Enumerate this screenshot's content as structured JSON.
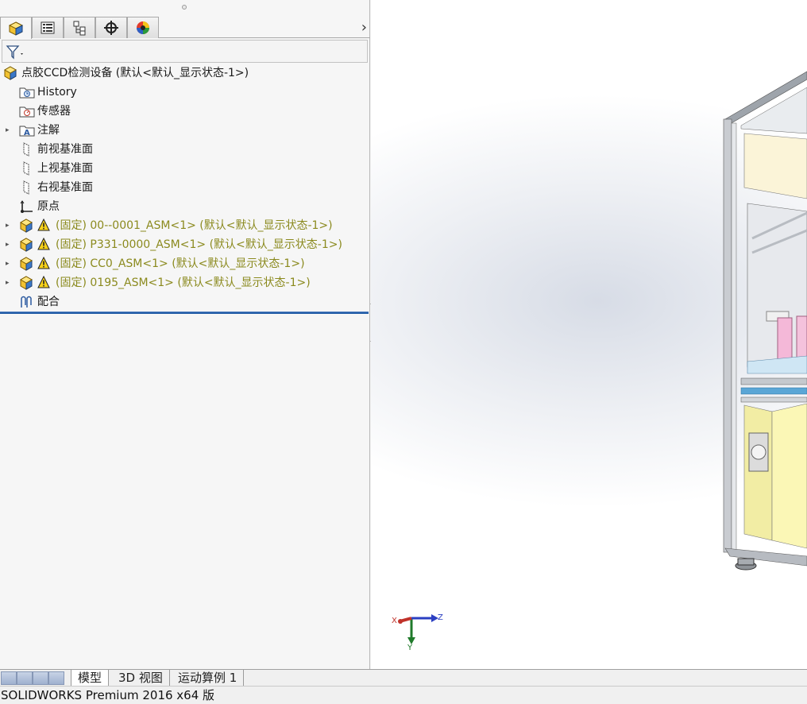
{
  "feature_tree": {
    "root": {
      "label": "点胶CCD检测设备  (默认<默认_显示状态-1>)",
      "icon": "assembly-icon"
    },
    "items": [
      {
        "label": "History",
        "icon": "history-folder-icon",
        "expandable": false
      },
      {
        "label": "传感器",
        "icon": "sensors-folder-icon",
        "expandable": false
      },
      {
        "label": "注解",
        "icon": "annotations-folder-icon",
        "expandable": true
      },
      {
        "label": "前视基准面",
        "icon": "plane-icon",
        "expandable": false
      },
      {
        "label": "上视基准面",
        "icon": "plane-icon",
        "expandable": false
      },
      {
        "label": "右视基准面",
        "icon": "plane-icon",
        "expandable": false
      },
      {
        "label": "原点",
        "icon": "origin-icon",
        "expandable": false
      },
      {
        "label": "(固定) 00--0001_ASM<1> (默认<默认_显示状态-1>)",
        "icon": "subassembly-icon",
        "warning": true,
        "expandable": true
      },
      {
        "label": "(固定) P331-0000_ASM<1> (默认<默认_显示状态-1>)",
        "icon": "subassembly-icon",
        "warning": true,
        "expandable": true
      },
      {
        "label": "(固定) CC0_ASM<1> (默认<默认_显示状态-1>)",
        "icon": "subassembly-icon",
        "warning": true,
        "expandable": true
      },
      {
        "label": "(固定) 0195_ASM<1> (默认<默认_显示状态-1>)",
        "icon": "subassembly-icon",
        "warning": true,
        "expandable": true
      },
      {
        "label": "配合",
        "icon": "mates-icon",
        "expandable": false
      }
    ]
  },
  "panel_tabs": [
    {
      "name": "featuremanager-tab",
      "icon": "featuremanager-icon",
      "active": true
    },
    {
      "name": "propertymanager-tab",
      "icon": "propertymanager-icon",
      "active": false
    },
    {
      "name": "configurationmanager-tab",
      "icon": "configurationmanager-icon",
      "active": false
    },
    {
      "name": "dimxpert-tab",
      "icon": "dimxpert-icon",
      "active": false
    },
    {
      "name": "displaymanager-tab",
      "icon": "displaymanager-icon",
      "active": false
    }
  ],
  "panel_more": "›",
  "filter": {
    "icon": "filter-icon"
  },
  "triad": {
    "x": "X",
    "y": "Y",
    "z": "Z"
  },
  "bottom_tabs": [
    "模型",
    "3D 视图",
    "运动算例 1"
  ],
  "status_bar": {
    "text": "SOLIDWORKS Premium 2016 x64 版"
  },
  "colors": {
    "warning_text": "#8b8a1e",
    "rollback_bar": "#1f5aa6",
    "panel_bg": "#f6f6f6"
  }
}
